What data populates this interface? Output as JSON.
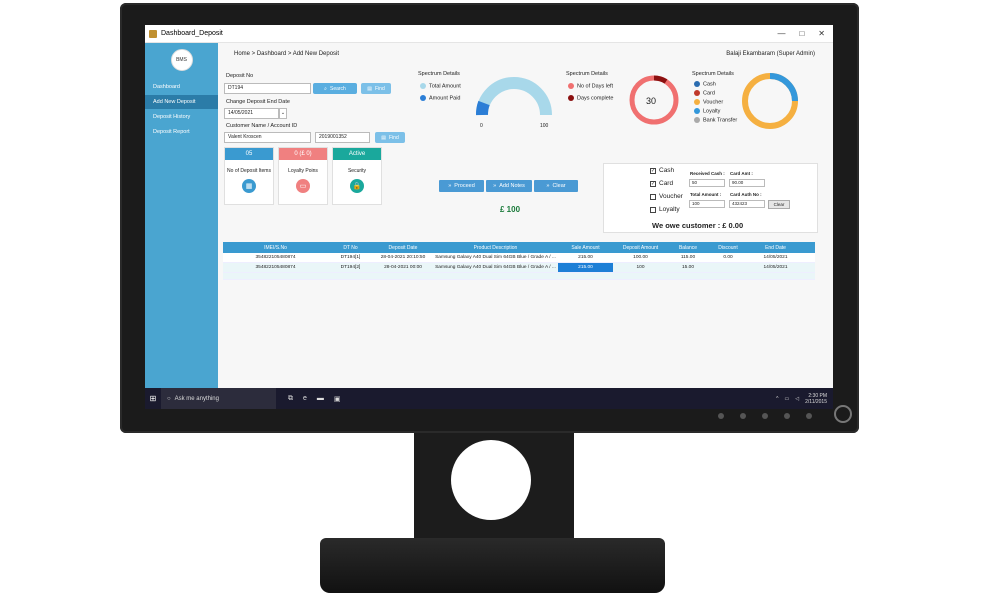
{
  "window": {
    "title": "Dashboard_Deposit",
    "minimize": "—",
    "maximize": "□",
    "close": "✕"
  },
  "sidebar": {
    "logo_text": "BMS",
    "items": [
      {
        "label": "Dashboard"
      },
      {
        "label": "Add New Deposit"
      },
      {
        "label": "Deposit History"
      },
      {
        "label": "Deposit Report"
      }
    ]
  },
  "header": {
    "breadcrumb": "Home > Dashboard > Add New Deposit",
    "user": "Balaji Ekambaram (Super Admin)"
  },
  "form": {
    "deposit_no_label": "Deposit No",
    "deposit_no_value": "DT194",
    "search_label": "Search",
    "find_label": "Find",
    "end_date_label": "Change Deposit End Date",
    "end_date_value": "14/05/2021",
    "customer_label": "Customer Name / Account ID",
    "customer_name": "Valent Kroscen",
    "account_id": "2019001352",
    "find2_label": "Find"
  },
  "tiles": [
    {
      "value": "05",
      "label": "No of Deposit Items",
      "color": "#3a9ad0"
    },
    {
      "value": "0 (£ 0)",
      "label": "Loyalty Poins",
      "color": "#f08080"
    },
    {
      "value": "Active",
      "label": "Security",
      "color": "#1aa89c"
    }
  ],
  "spectrum1": {
    "title": "Spectrum Details",
    "legend": [
      "Total Amount",
      "Amount Paid"
    ],
    "min": "0",
    "max": "100",
    "colors": [
      "#a8d8ea",
      "#2b7ed6"
    ]
  },
  "spectrum2": {
    "title": "Spectrum Details",
    "legend": [
      "No of Days left",
      "Days complete"
    ],
    "center": "30",
    "colors": [
      "#f07070",
      "#8b1010"
    ]
  },
  "spectrum3": {
    "title": "Spectrum Details",
    "legend": [
      "Cash",
      "Card",
      "Voucher",
      "Loyalty",
      "Bank Transfer"
    ],
    "colors": [
      "#2b6cb0",
      "#c0392b",
      "#f5b041",
      "#3498db",
      "#aaaaaa"
    ]
  },
  "actions": {
    "proceed": "Proceed",
    "add_notes": "Add Notes",
    "clear": "Clear",
    "amount": "£  100"
  },
  "payment": {
    "cash": "Cash",
    "card": "Card",
    "voucher": "Voucher",
    "loyalty": "Loyalty",
    "received_cash_label": "Received Cash :",
    "received_cash": "50",
    "card_amt_label": "Card Amt :",
    "card_amt": "90.00",
    "total_amount_label": "Total Amount :",
    "total_amount": "100",
    "card_auth_label": "Card Auth No :",
    "card_auth": "432423",
    "clear": "Clear",
    "owe": "We owe customer : £ 0.00"
  },
  "table": {
    "headers": [
      "IMEI/S.No",
      "DT No",
      "Deposit Date",
      "Product Description",
      "Sale Amount",
      "Deposit Amount",
      "Balance",
      "Discount",
      "End Date"
    ],
    "rows": [
      [
        "354822105480874",
        "DT194[1]",
        "28-04-2021 20:10:50",
        "Samsung Galaxy A40 Dual Sim 64GB Blue / Grade A / ...",
        "215.00",
        "100.00",
        "115.00",
        "0.00",
        "14/05/2021"
      ],
      [
        "354822105480874",
        "DT194[2]",
        "28-04-2021 00:00",
        "Samsung Galaxy A40 Dual Sim 64GB Blue / Grade A / ...",
        "215.00",
        "100",
        "15.00",
        "",
        "14/05/2021"
      ]
    ]
  },
  "taskbar": {
    "search_placeholder": "Ask me anything",
    "time": "2:30 PM",
    "date": "2/11/2015"
  }
}
